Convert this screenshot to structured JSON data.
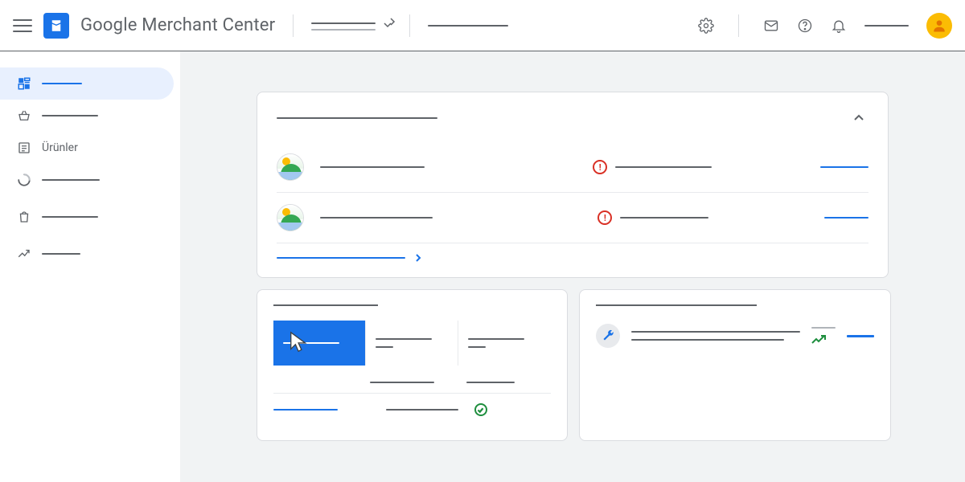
{
  "header": {
    "app_title": "Google Merchant Center",
    "account_dropdown": "",
    "search_placeholder": ""
  },
  "sidebar": {
    "items": [
      {
        "id": "overview",
        "label": "",
        "active": true
      },
      {
        "id": "basket",
        "label": "",
        "active": false
      },
      {
        "id": "products",
        "label": "Ürünler",
        "active": false
      },
      {
        "id": "diagnostics",
        "label": "",
        "active": false
      },
      {
        "id": "marketing",
        "label": "",
        "active": false
      },
      {
        "id": "performance",
        "label": "",
        "active": false
      }
    ]
  },
  "card1": {
    "title": "",
    "rows": [
      {
        "name": "",
        "status": "",
        "action": ""
      },
      {
        "name": "",
        "status": "",
        "action": ""
      }
    ],
    "footer_link": ""
  },
  "card2": {
    "title": "",
    "tabs": [
      {
        "label": ""
      },
      {
        "label": "",
        "sub": ""
      },
      {
        "label": "",
        "sub": ""
      }
    ],
    "table": [
      {
        "col1": "",
        "col2": "",
        "ok": true
      }
    ]
  },
  "card3": {
    "title": "",
    "rec": {
      "line1": "",
      "line2": "",
      "metric": "",
      "action": ""
    }
  }
}
